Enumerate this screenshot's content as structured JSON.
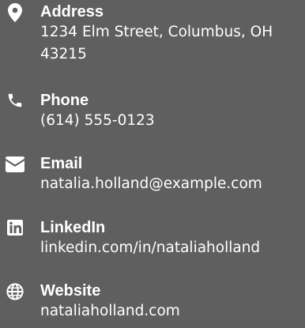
{
  "contacts": {
    "address": {
      "icon": "map-marker-icon",
      "label": "Address",
      "value": "1234 Elm Street, Columbus, OH 43215"
    },
    "phone": {
      "icon": "phone-icon",
      "label": "Phone",
      "value": "(614) 555-0123"
    },
    "email": {
      "icon": "envelope-icon",
      "label": "Email",
      "value": "natalia.holland@example.com"
    },
    "linkedin": {
      "icon": "linkedin-icon",
      "label": "LinkedIn",
      "value": "linkedin.com/in/nataliaholland"
    },
    "website": {
      "icon": "globe-icon",
      "label": "Website",
      "value": "nataliaholland.com"
    }
  },
  "colors": {
    "background": "#5f5f5f",
    "text": "#ffffff"
  }
}
